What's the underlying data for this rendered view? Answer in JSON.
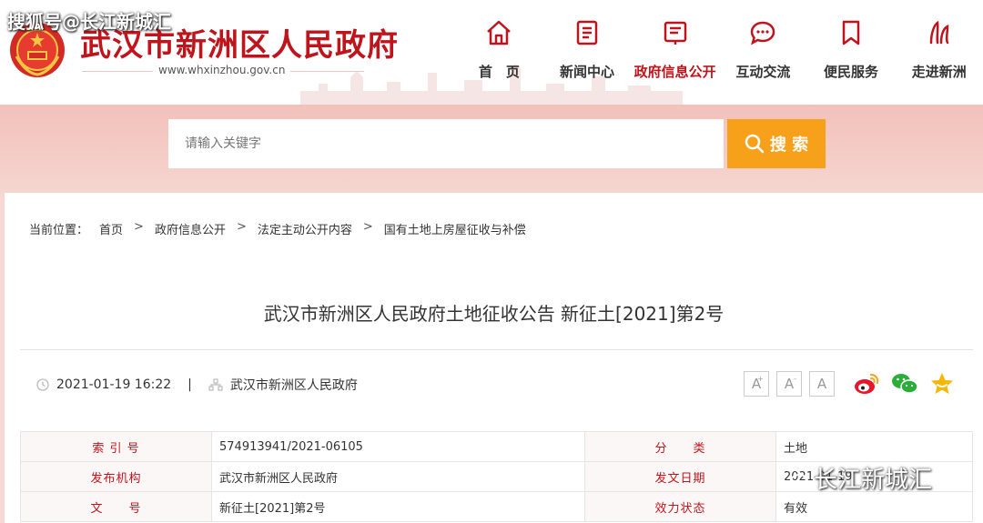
{
  "watermark": {
    "top_left": "搜狐号@长江新城汇",
    "bottom_right": "长江新城汇"
  },
  "site": {
    "title": "武汉市新洲区人民政府",
    "url": "www.whxinzhou.gov.cn"
  },
  "nav": {
    "items": [
      {
        "label": "首　页",
        "icon": "home-icon"
      },
      {
        "label": "新闻中心",
        "icon": "news-icon"
      },
      {
        "label": "政府信息公开",
        "icon": "gov-info-icon",
        "active": true
      },
      {
        "label": "互动交流",
        "icon": "chat-icon"
      },
      {
        "label": "便民服务",
        "icon": "bookmark-icon"
      },
      {
        "label": "走进新洲",
        "icon": "landmark-icon"
      }
    ]
  },
  "search": {
    "placeholder": "请输入关键字",
    "button_label": "搜 索"
  },
  "breadcrumb": {
    "prefix": "当前位置：",
    "items": [
      "首页",
      "政府信息公开",
      "法定主动公开内容",
      "国有土地上房屋征收与补偿"
    ],
    "separator": ">"
  },
  "article": {
    "title": "武汉市新洲区人民政府土地征收公告 新征土[2021]第2号",
    "date": "2021-01-19 16:22",
    "pipe": "|",
    "source": "武汉市新洲区人民政府"
  },
  "font_controls": {
    "larger": "A",
    "normal": "A",
    "smaller": "A"
  },
  "info_table": {
    "rows": [
      {
        "label1": "索 引 号",
        "value1": "574913941/2021-06105",
        "label2": "分　　类",
        "value2": "土地"
      },
      {
        "label1": "发布机构",
        "value1": "武汉市新洲区人民政府",
        "label2": "发文日期",
        "value2": "2021-01-19"
      },
      {
        "label1": "文　　号",
        "value1": "新征土[2021]第2号",
        "label2": "效力状态",
        "value2": "有效"
      }
    ]
  },
  "colors": {
    "brand_red": "#c0141c",
    "search_orange": "#f7a11a",
    "band_pink": "#f2c1ba"
  }
}
